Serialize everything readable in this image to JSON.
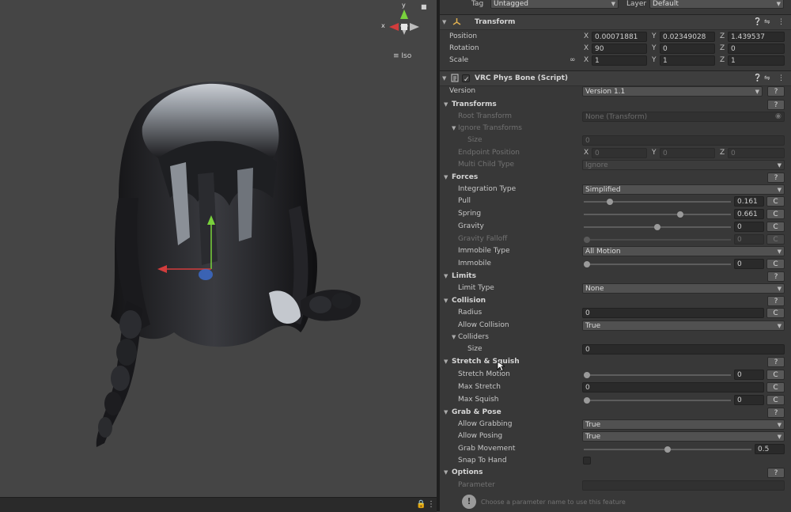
{
  "scene": {
    "gizmo": {
      "x_label": "x",
      "y_label": "y",
      "mode_label": "Iso"
    }
  },
  "header_row": {
    "tag_label": "Tag",
    "tag_value": "Untagged",
    "layer_label": "Layer",
    "layer_value": "Default"
  },
  "transform": {
    "title": "Transform",
    "position": {
      "label": "Position",
      "x": "0.00071881",
      "y": "0.02349028",
      "z": "1.439537"
    },
    "rotation": {
      "label": "Rotation",
      "x": "90",
      "y": "0",
      "z": "0"
    },
    "scale": {
      "label": "Scale",
      "x": "1",
      "y": "1",
      "z": "1"
    },
    "axes": {
      "x": "X",
      "y": "Y",
      "z": "Z"
    }
  },
  "physbone": {
    "title": "VRC Phys Bone (Script)",
    "version": {
      "label": "Version",
      "value": "Version 1.1",
      "help": "?"
    },
    "transforms": {
      "title": "Transforms",
      "root_transform": {
        "label": "Root Transform",
        "value": "None (Transform)"
      },
      "ignore_transforms": {
        "label": "Ignore Transforms"
      },
      "size": {
        "label": "Size",
        "value": "0"
      },
      "endpoint_position": {
        "label": "Endpoint Position",
        "x": "0",
        "y": "0",
        "z": "0"
      },
      "multi_child_type": {
        "label": "Multi Child Type",
        "value": "Ignore"
      }
    },
    "forces": {
      "title": "Forces",
      "integration_type": {
        "label": "Integration Type",
        "value": "Simplified"
      },
      "pull": {
        "label": "Pull",
        "value": "0.161",
        "fraction": 0.161
      },
      "spring": {
        "label": "Spring",
        "value": "0.661",
        "fraction": 0.661
      },
      "gravity": {
        "label": "Gravity",
        "value": "0",
        "fraction": 0.5
      },
      "gravity_falloff": {
        "label": "Gravity Falloff",
        "value": "0",
        "fraction": 0
      },
      "immobile_type": {
        "label": "Immobile Type",
        "value": "All Motion"
      },
      "immobile": {
        "label": "Immobile",
        "value": "0",
        "fraction": 0
      }
    },
    "limits": {
      "title": "Limits",
      "limit_type": {
        "label": "Limit Type",
        "value": "None"
      }
    },
    "collision": {
      "title": "Collision",
      "radius": {
        "label": "Radius",
        "value": "0"
      },
      "allow_collision": {
        "label": "Allow Collision",
        "value": "True"
      },
      "colliders": {
        "label": "Colliders"
      },
      "size": {
        "label": "Size",
        "value": "0"
      }
    },
    "stretch": {
      "title": "Stretch & Squish",
      "stretch_motion": {
        "label": "Stretch Motion",
        "value": "0",
        "fraction": 0
      },
      "max_stretch": {
        "label": "Max Stretch",
        "value": "0"
      },
      "max_squish": {
        "label": "Max Squish",
        "value": "0",
        "fraction": 0
      }
    },
    "grab": {
      "title": "Grab & Pose",
      "allow_grabbing": {
        "label": "Allow Grabbing",
        "value": "True"
      },
      "allow_posing": {
        "label": "Allow Posing",
        "value": "True"
      },
      "grab_movement": {
        "label": "Grab Movement",
        "value": "0.5",
        "fraction": 0.5
      },
      "snap_to_hand": {
        "label": "Snap To Hand"
      }
    },
    "options": {
      "title": "Options",
      "parameter": {
        "label": "Parameter"
      },
      "hint": "Choose a parameter name to use this feature"
    },
    "c_label": "C",
    "help_label": "?"
  },
  "colors": {
    "accent_x": "#d23c3c",
    "accent_y": "#79d23c",
    "accent_z": "#3c6ed2",
    "panel_bg": "#383838",
    "scene_bg": "#454545"
  }
}
